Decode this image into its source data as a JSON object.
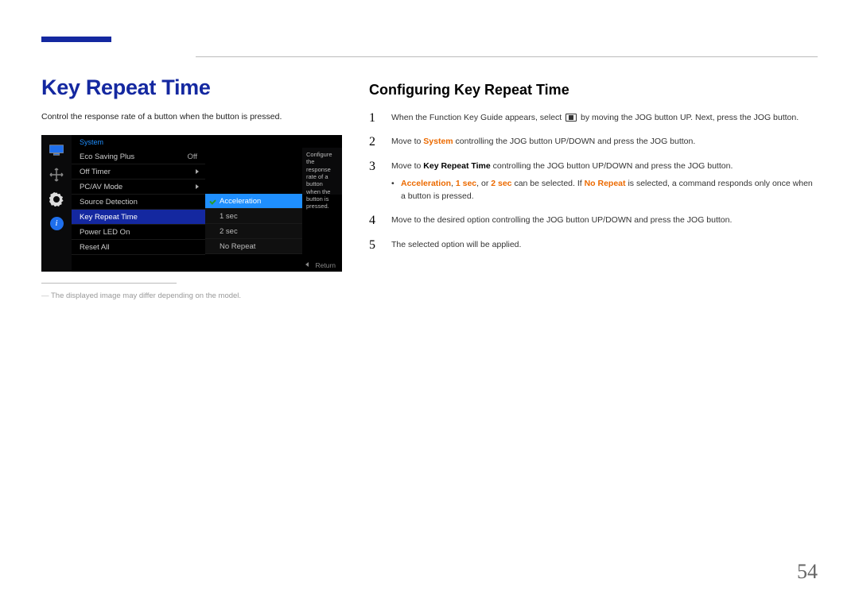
{
  "layout": {
    "page_number": "54"
  },
  "left": {
    "title": "Key Repeat Time",
    "description": "Control the response rate of a button when the button is pressed.",
    "footnote": "The displayed image may differ depending on the model."
  },
  "osd": {
    "header": "System",
    "items": [
      {
        "label": "Eco Saving Plus",
        "value": "Off"
      },
      {
        "label": "Off Timer",
        "value": ""
      },
      {
        "label": "PC/AV Mode",
        "value": ""
      },
      {
        "label": "Source Detection",
        "value": ""
      },
      {
        "label": "Key Repeat Time",
        "value": ""
      },
      {
        "label": "Power LED On",
        "value": ""
      },
      {
        "label": "Reset All",
        "value": ""
      }
    ],
    "sub_items": [
      "Acceleration",
      "1 sec",
      "2 sec",
      "No Repeat"
    ],
    "desc_box": "Configure the response rate of a button when the button is pressed.",
    "footer": "Return"
  },
  "right": {
    "subtitle": "Configuring Key Repeat Time",
    "steps": {
      "s1a": "When the Function Key Guide appears, select ",
      "s1b": " by moving the JOG button UP. Next, press the JOG button.",
      "s2a": "Move to ",
      "s2_key": "System",
      "s2b": " controlling the JOG button UP/DOWN and press the JOG button.",
      "s3a": "Move to ",
      "s3_key": "Key Repeat Time",
      "s3b": " controlling the JOG button UP/DOWN and press the JOG button.",
      "bullet_k1": "Acceleration",
      "bullet_sep1": ", ",
      "bullet_k2": "1 sec",
      "bullet_sep2": ", or ",
      "bullet_k3": "2 sec",
      "bullet_mid": " can be selected. If ",
      "bullet_k4": "No Repeat",
      "bullet_end": " is selected, a command responds only once when a button is pressed.",
      "s4": "Move to the desired option controlling the JOG button UP/DOWN and press the JOG button.",
      "s5": "The selected option will be applied."
    }
  }
}
